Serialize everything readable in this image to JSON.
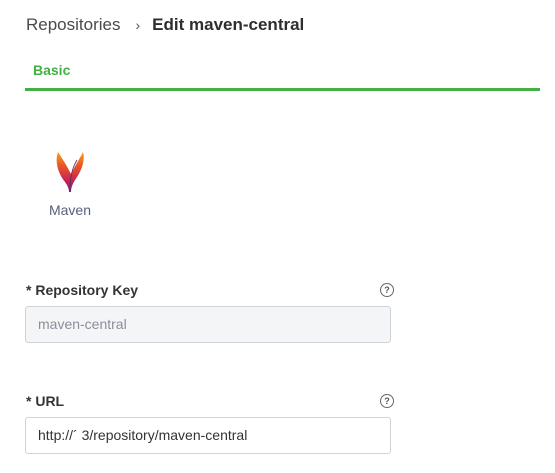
{
  "breadcrumb": {
    "parent": "Repositories",
    "separator": "›",
    "current": "Edit maven-central"
  },
  "tabs": [
    {
      "label": "Basic",
      "active": true
    }
  ],
  "package_type": {
    "icon": "apache-feather-icon",
    "label": "Maven"
  },
  "form": {
    "repo_key": {
      "label": "* Repository Key",
      "value": "maven-central",
      "help_icon": "?"
    },
    "url": {
      "label": "* URL",
      "value": "http://´                              3/repository/maven-central",
      "help_icon": "?"
    }
  },
  "colors": {
    "accent": "#43b043",
    "input_border": "#cfd3da",
    "disabled_bg": "#f4f5f7"
  }
}
